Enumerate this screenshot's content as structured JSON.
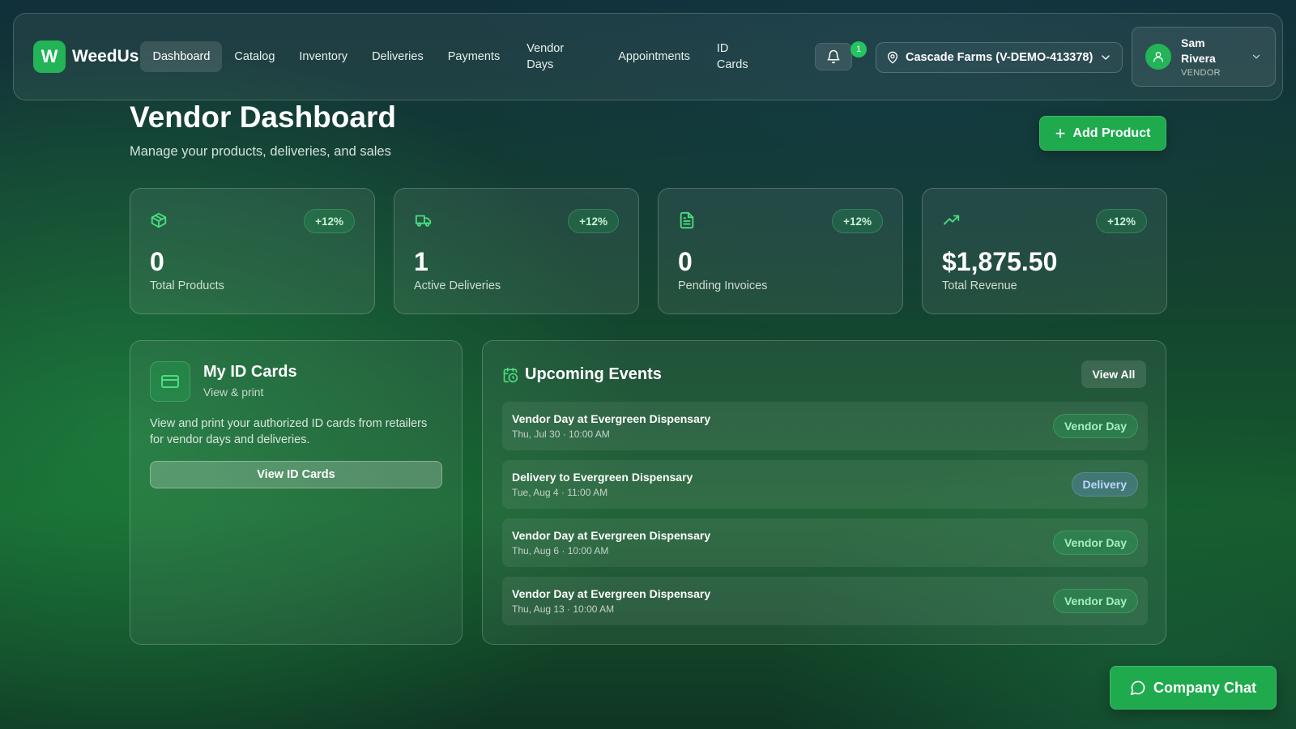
{
  "brand": {
    "logo_letter": "W",
    "name": "WeedUs",
    "accent": "#22b457"
  },
  "nav": {
    "items": [
      {
        "label": "Dashboard",
        "active": true
      },
      {
        "label": "Catalog"
      },
      {
        "label": "Inventory"
      },
      {
        "label": "Deliveries"
      },
      {
        "label": "Payments"
      },
      {
        "label": "Vendor Days"
      },
      {
        "label": "Appointments"
      },
      {
        "label": "ID Cards"
      }
    ],
    "notifications": {
      "icon": "bell-icon",
      "count": "1"
    },
    "location": {
      "icon": "map-pin-icon",
      "label": "Cascade Farms (V-DEMO-413378)"
    },
    "user": {
      "name": "Sam Rivera",
      "role": "VENDOR"
    }
  },
  "header": {
    "title": "Vendor Dashboard",
    "subtitle": "Manage your products, deliveries, and sales",
    "add_button": "Add Product"
  },
  "stats": [
    {
      "icon": "package-icon",
      "change": "+12%",
      "value": "0",
      "label": "Total Products"
    },
    {
      "icon": "truck-icon",
      "change": "+12%",
      "value": "1",
      "label": "Active Deliveries"
    },
    {
      "icon": "file-text-icon",
      "change": "+12%",
      "value": "0",
      "label": "Pending Invoices"
    },
    {
      "icon": "trending-up-icon",
      "change": "+12%",
      "value": "$1,875.50",
      "label": "Total Revenue"
    }
  ],
  "id_cards": {
    "title": "My ID Cards",
    "subtitle": "View & print",
    "description": "View and print your authorized ID cards from retailers for vendor days and deliveries.",
    "button": "View ID Cards"
  },
  "events": {
    "title": "Upcoming Events",
    "view_all": "View All",
    "items": [
      {
        "name": "Vendor Day at Evergreen Dispensary",
        "time": "Thu, Jul 30 · 10:00 AM",
        "tag": "Vendor Day",
        "type": "vendor"
      },
      {
        "name": "Delivery to Evergreen Dispensary",
        "time": "Tue, Aug 4 · 11:00 AM",
        "tag": "Delivery",
        "type": "delivery"
      },
      {
        "name": "Vendor Day at Evergreen Dispensary",
        "time": "Thu, Aug 6 · 10:00 AM",
        "tag": "Vendor Day",
        "type": "vendor"
      },
      {
        "name": "Vendor Day at Evergreen Dispensary",
        "time": "Thu, Aug 13 · 10:00 AM",
        "tag": "Vendor Day",
        "type": "vendor"
      }
    ]
  },
  "chat": {
    "label": "Company Chat"
  }
}
